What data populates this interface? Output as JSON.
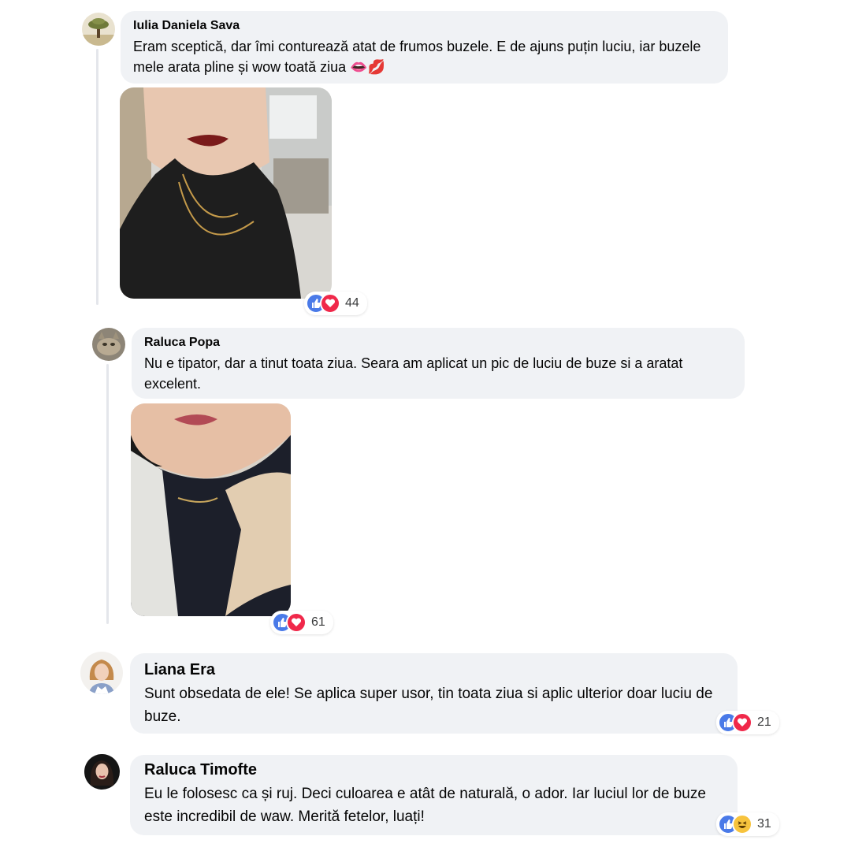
{
  "comments": [
    {
      "author": "Iulia Daniela Sava",
      "text": "Eram sceptică, dar îmi conturează atat de frumos buzele. E de ajuns puțin luciu, iar buzele mele arata pline și wow toată ziua 👄💋",
      "reactions": {
        "icons": [
          "like-icon",
          "love-icon"
        ],
        "count": "44"
      }
    },
    {
      "author": "Raluca Popa",
      "text": "Nu e tipator, dar a tinut toata ziua. Seara am aplicat un pic de luciu de buze si a aratat excelent.",
      "reactions": {
        "icons": [
          "like-icon",
          "love-icon"
        ],
        "count": "61"
      }
    },
    {
      "author": "Liana Era",
      "text": "Sunt obsedata de ele! Se aplica super usor, tin toata ziua si aplic ulterior doar luciu de buze.",
      "reactions": {
        "icons": [
          "like-icon",
          "love-icon"
        ],
        "count": "21"
      }
    },
    {
      "author": "Raluca Timofte",
      "text": "Eu le folosesc ca și ruj. Deci culoarea e atât de naturală, o ador. Iar luciul lor de buze este incredibil de waw. Merită fetelor, luați!",
      "reactions": {
        "icons": [
          "like-icon",
          "haha-icon"
        ],
        "count": "31"
      }
    }
  ],
  "colors": {
    "bubble": "#f0f2f5",
    "like": "#4a7ae8",
    "love": "#f0284a",
    "haha": "#f7c33d"
  }
}
